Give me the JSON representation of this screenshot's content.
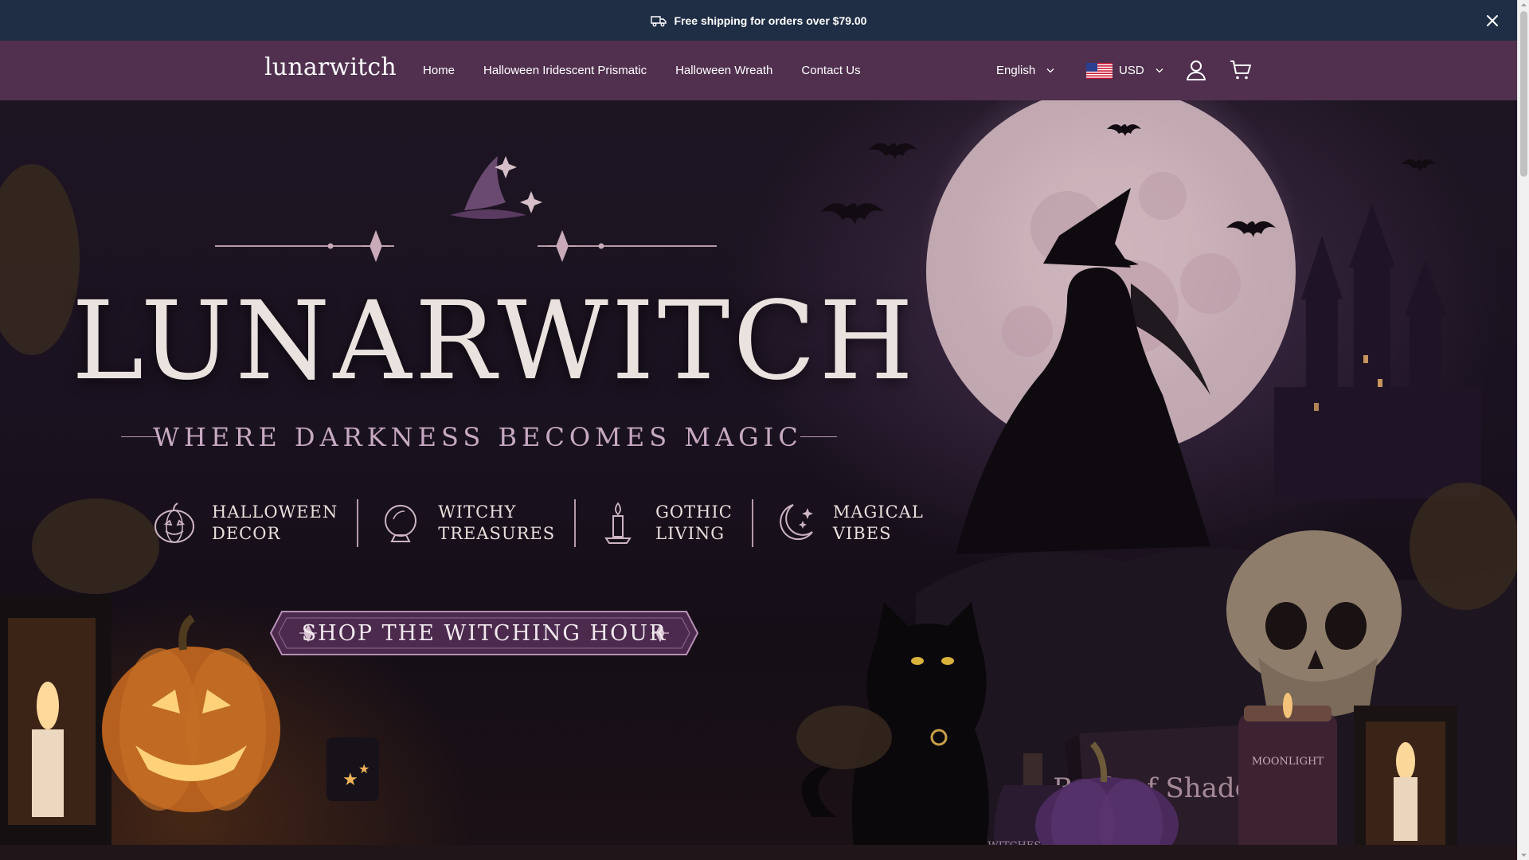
{
  "announcement": {
    "text": "Free shipping for orders over $79.00",
    "icon": "truck-icon"
  },
  "header": {
    "logo": "lunarwitch",
    "nav": [
      {
        "label": "Home"
      },
      {
        "label": "Halloween Iridescent Prismatic"
      },
      {
        "label": "Halloween Wreath"
      },
      {
        "label": "Contact Us"
      }
    ],
    "language": "English",
    "currency": "USD"
  },
  "hero": {
    "title": "LUNARWITCH",
    "tagline": "WHERE DARKNESS BECOMES MAGIC",
    "features": [
      {
        "label": "HALLOWEEN\nDECOR",
        "icon": "pumpkin-icon"
      },
      {
        "label": "WITCHY\nTREASURES",
        "icon": "crystal-ball-icon"
      },
      {
        "label": "GOTHIC\nLIVING",
        "icon": "candle-icon"
      },
      {
        "label": "MAGICAL\nVIBES",
        "icon": "crescent-moon-icon"
      }
    ],
    "cta": "SHOP THE WITCHING HOUR",
    "book_title": "Book of Shadows",
    "potion_label": "WITCHES BREW",
    "candle_label": "MOONLIGHT"
  },
  "colors": {
    "announcement_bg": "#1f2d45",
    "header_bg": "#51304f",
    "accent": "#c7a9c2"
  }
}
